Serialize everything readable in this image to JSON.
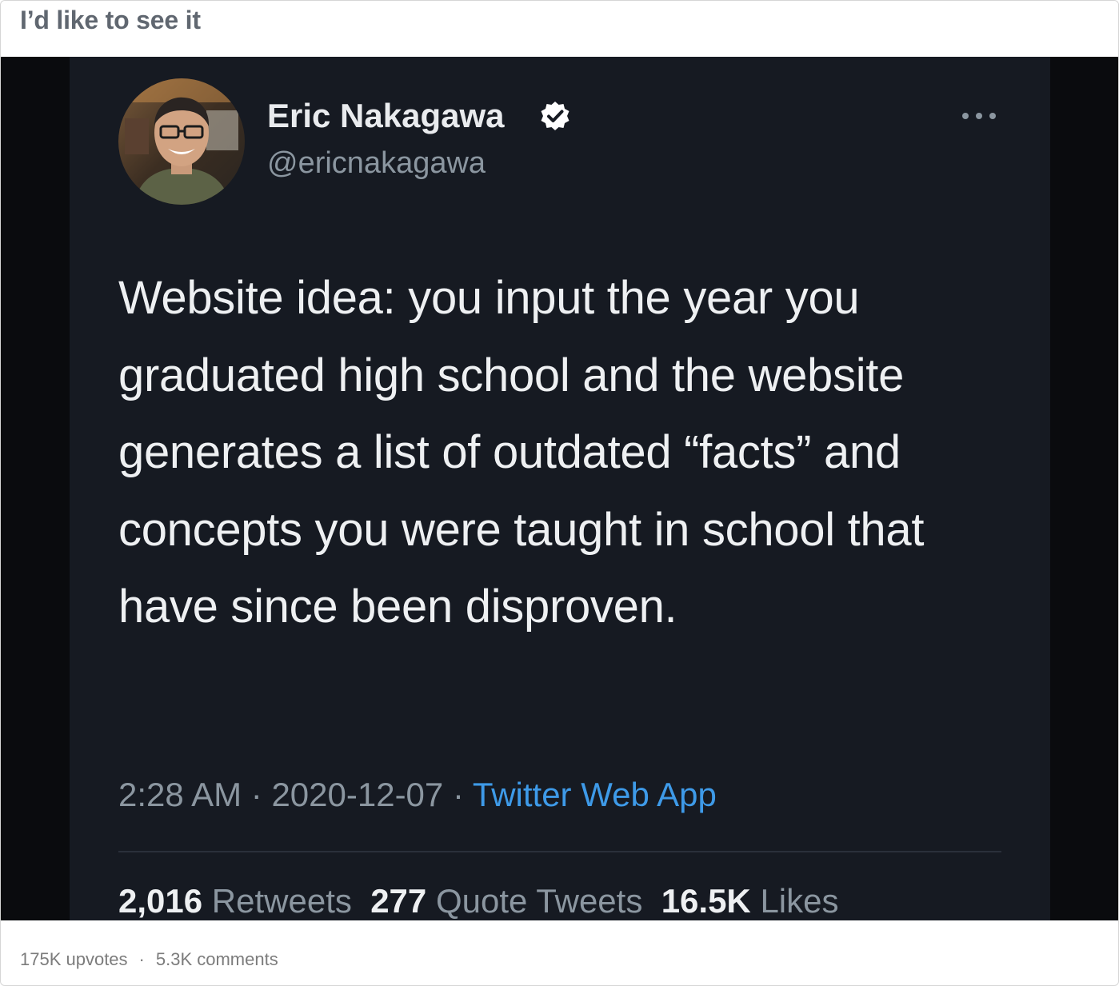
{
  "post": {
    "title": "I’d like to see it"
  },
  "tweet": {
    "display_name": "Eric Nakagawa",
    "handle": "@ericnakagawa",
    "text": "Website idea: you input the year you graduated high school and the website generates a list of outdated “facts” and concepts you were taught in school that have since been disproven.",
    "time": "2:28 AM",
    "date": "2020-12-07",
    "separator": " · ",
    "source": "Twitter Web App",
    "stats": {
      "retweets_count": "2,016",
      "retweets_label": "Retweets",
      "quote_count": "277",
      "quote_label": "Quote Tweets",
      "likes_count": "16.5K",
      "likes_label": "Likes"
    },
    "icons": {
      "verified": "verified-badge-icon",
      "more": "more-options-icon"
    },
    "colors": {
      "background": "#161a22",
      "link": "#3e9ae8",
      "text": "#eef0f2",
      "muted": "#8b96a0"
    }
  },
  "footer": {
    "upvotes": "175K upvotes",
    "separator": "·",
    "comments": "5.3K comments"
  }
}
